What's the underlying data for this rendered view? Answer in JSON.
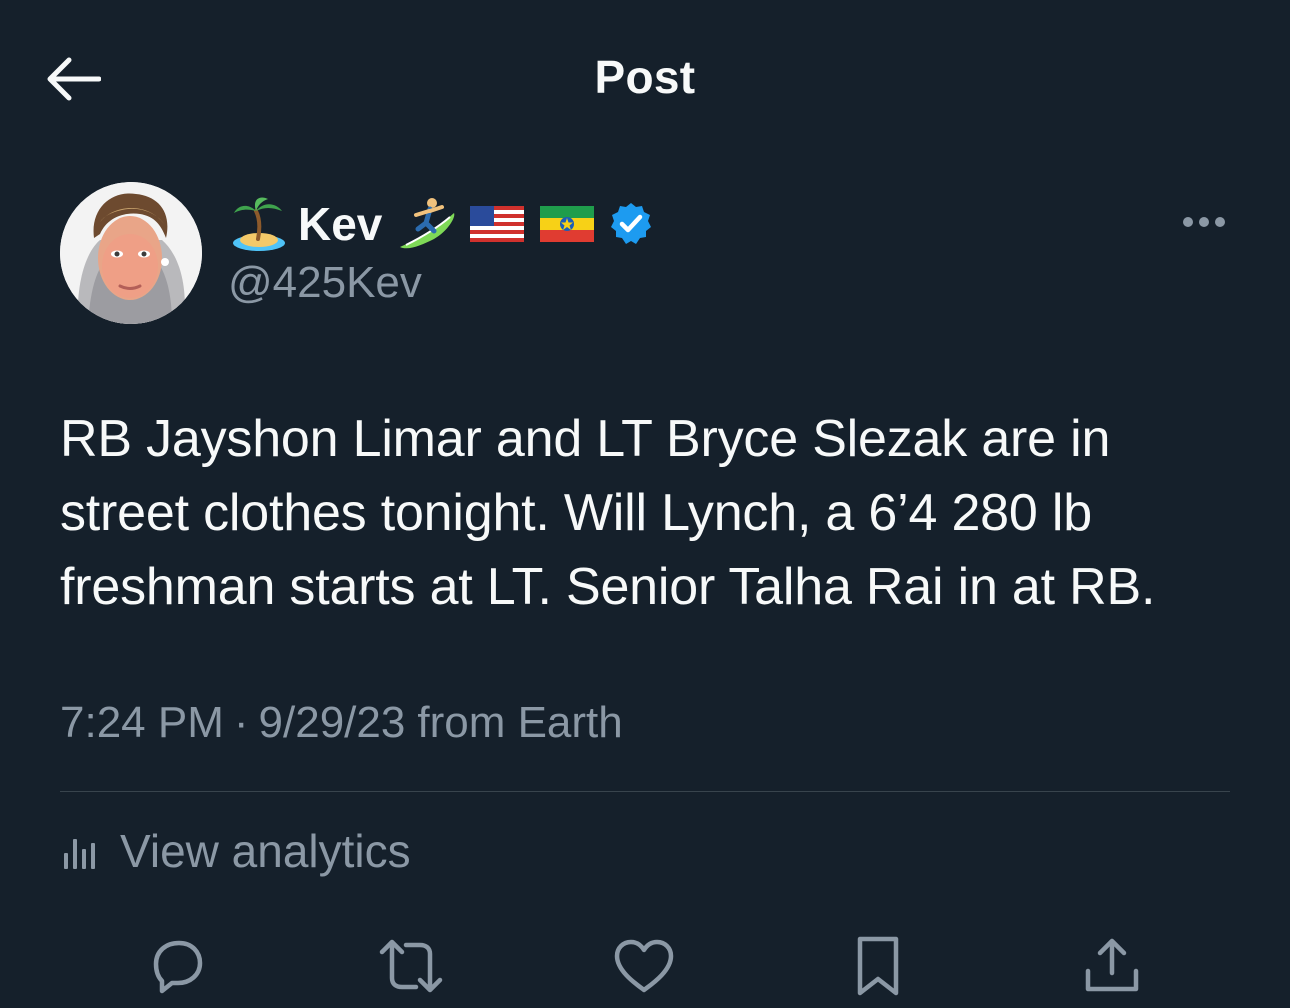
{
  "header": {
    "title": "Post",
    "back_icon": "arrow-left-icon"
  },
  "author": {
    "display_name": "Kev",
    "handle": "@425Kev",
    "name_emojis": [
      "desert-island-emoji",
      "surfer-emoji",
      "us-flag-emoji",
      "ethiopia-flag-emoji"
    ],
    "verified": true,
    "verified_color": "#1d9bf0"
  },
  "tweet": {
    "text": "RB Jayshon Limar and LT Bryce Slezak are in street clothes tonight. Will Lynch, a 6’4 280 lb freshman starts at LT. Senior Talha Rai in at RB."
  },
  "meta": {
    "time": "7:24 PM",
    "separator": "·",
    "date": "9/29/23",
    "source": "from Earth"
  },
  "analytics": {
    "label": "View analytics",
    "icon": "analytics-bars-icon"
  },
  "actions": [
    {
      "name": "reply",
      "icon": "reply-bubble-icon"
    },
    {
      "name": "repost",
      "icon": "repost-icon"
    },
    {
      "name": "like",
      "icon": "heart-icon"
    },
    {
      "name": "bookmark",
      "icon": "bookmark-icon"
    },
    {
      "name": "share",
      "icon": "share-icon"
    }
  ],
  "colors": {
    "background": "#15202b",
    "text_primary": "#f7f9f9",
    "text_secondary": "#8b98a5",
    "divider": "#38444d",
    "accent": "#1d9bf0"
  }
}
